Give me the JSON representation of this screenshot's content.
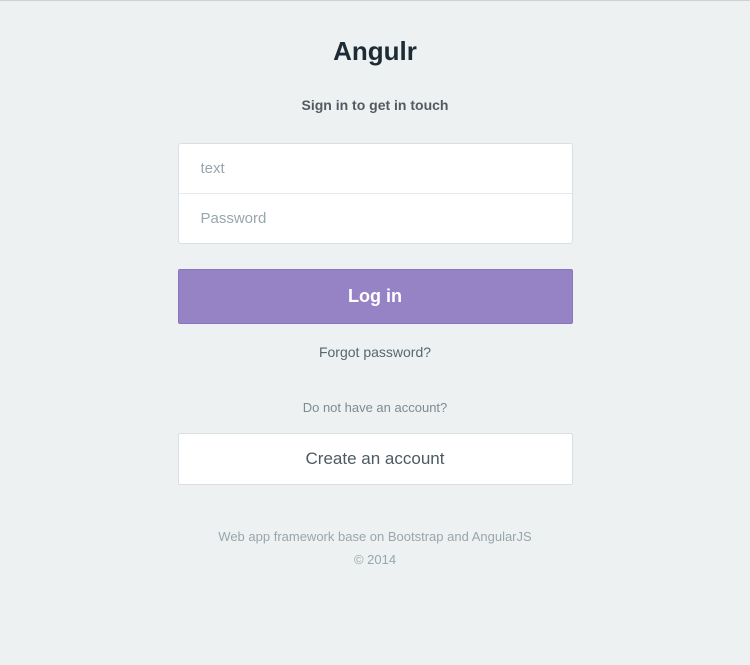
{
  "brand": "Angulr",
  "subtitle": "Sign in to get in touch",
  "form": {
    "textPlaceholder": "text",
    "passwordPlaceholder": "Password",
    "loginButton": "Log in",
    "forgotLink": "Forgot password?",
    "accountPrompt": "Do not have an account?",
    "createAccountButton": "Create an account"
  },
  "footer": {
    "line1": "Web app framework base on Bootstrap and AngularJS",
    "line2": "© 2014"
  },
  "colors": {
    "background": "#edf1f2",
    "primary": "#9683c6",
    "text": "#58666e"
  }
}
